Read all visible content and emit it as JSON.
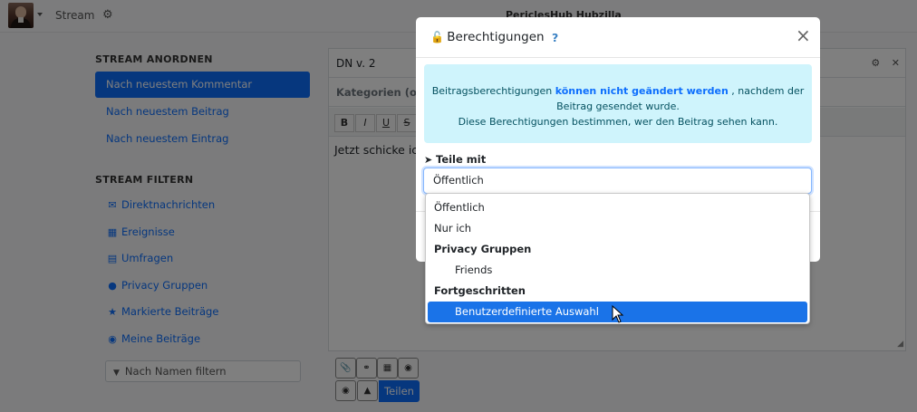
{
  "navbar": {
    "stream_label": "Stream",
    "settings_icon": "gear-icon",
    "site_name": "PericlesHub Hubzilla"
  },
  "sidebar": {
    "order_heading": "STREAM ANORDNEN",
    "order_items": [
      {
        "label": "Nach neuestem Kommentar",
        "active": true
      },
      {
        "label": "Nach neuestem Beitrag",
        "active": false
      },
      {
        "label": "Nach neuestem Eintrag",
        "active": false
      }
    ],
    "filter_heading": "STREAM FILTERN",
    "filter_items": [
      {
        "label": "Direktnachrichten",
        "icon": "envelope-icon"
      },
      {
        "label": "Ereignisse",
        "icon": "calendar-icon"
      },
      {
        "label": "Umfragen",
        "icon": "bar-chart-icon"
      },
      {
        "label": "Privacy Gruppen",
        "icon": "users-icon"
      },
      {
        "label": "Markierte Beiträge",
        "icon": "star-icon"
      },
      {
        "label": "Meine Beiträge",
        "icon": "user-circle-icon"
      }
    ],
    "name_filter_placeholder": "Nach Namen filtern"
  },
  "editor": {
    "title_value": "DN v. 2",
    "categories_placeholder": "Kategorien (opt",
    "toolbar": [
      "B",
      "I",
      "U",
      "S"
    ],
    "body_text": "Jetzt schicke ic",
    "share_button": "Teilen"
  },
  "modal": {
    "title": "Berechtigungen",
    "help": "?",
    "close": "×",
    "info_part1": "Beitragsberechtigungen ",
    "info_bold": "können nicht geändert werden",
    "info_part2": " , nachdem der Beitrag gesendet wurde.",
    "info_line2": "Diese Berechtigungen bestimmen, wer den Beitrag sehen kann.",
    "share_label": "Teile mit",
    "select_value": "Öffentlich"
  },
  "dropdown": {
    "options": [
      {
        "label": "Öffentlich",
        "type": "option"
      },
      {
        "label": "Nur ich",
        "type": "option"
      },
      {
        "label": "Privacy Gruppen",
        "type": "group"
      },
      {
        "label": "Friends",
        "type": "sub"
      },
      {
        "label": "Fortgeschritten",
        "type": "group"
      },
      {
        "label": "Benutzerdefinierte Auswahl",
        "type": "sub",
        "selected": true
      }
    ]
  },
  "colors": {
    "primary": "#0d6efd",
    "info_bg": "#cff4fc"
  }
}
